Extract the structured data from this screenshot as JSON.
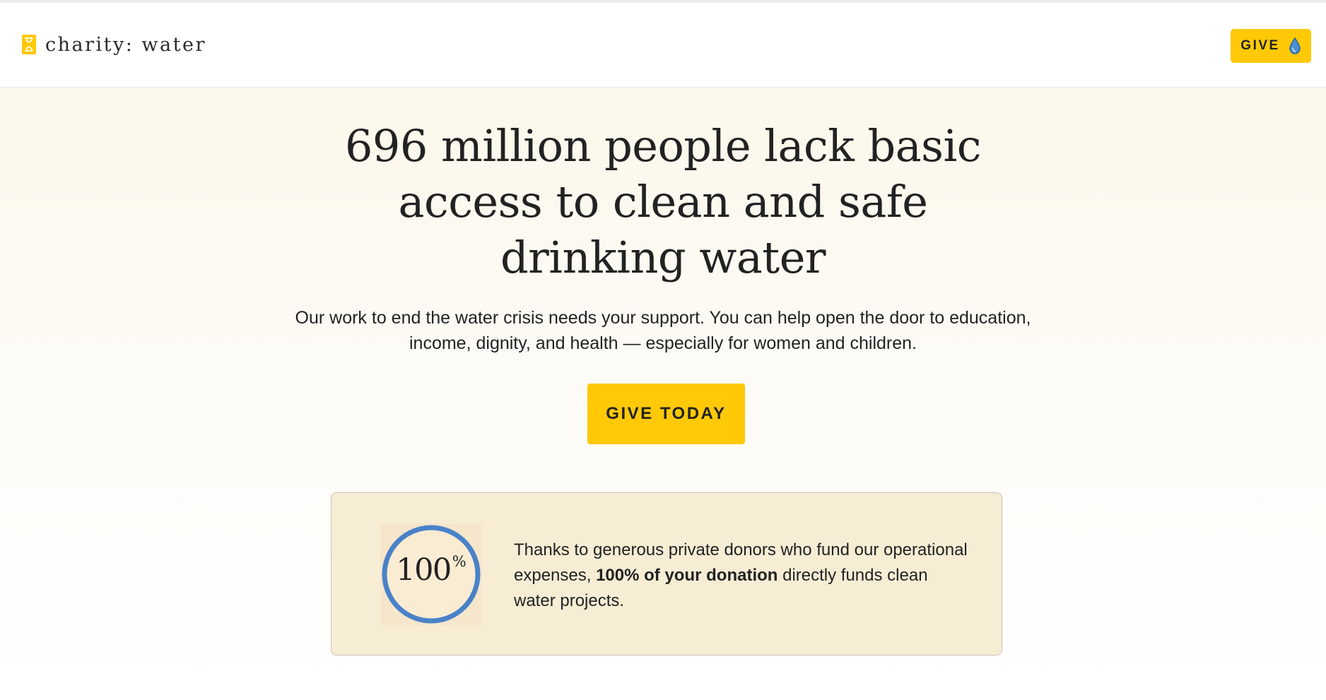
{
  "header": {
    "logo_text": "charity: water",
    "give_label": "GIVE",
    "logo_icon": "jerrycan-icon",
    "give_icon": "water-drop-icon"
  },
  "hero": {
    "headline_lines": [
      "696 million people lack basic",
      "access to clean and safe",
      "drinking water"
    ],
    "subtext_lines": [
      "Our work to end the water crisis needs your support. You can help open the door to education,",
      "income, dignity, and health — especially for women and children."
    ],
    "cta_label": "GIVE TODAY"
  },
  "promise": {
    "badge_number": "100",
    "badge_suffix": "%",
    "text_before": "Thanks to generous private donors who fund our operational expenses, ",
    "text_bold": "100% of your donation",
    "text_after": " directly funds clean water projects."
  },
  "colors": {
    "brand_yellow": "#ffc907",
    "ring_blue": "#4a82c8",
    "card_background": "#f7edd5",
    "text": "#222222"
  }
}
